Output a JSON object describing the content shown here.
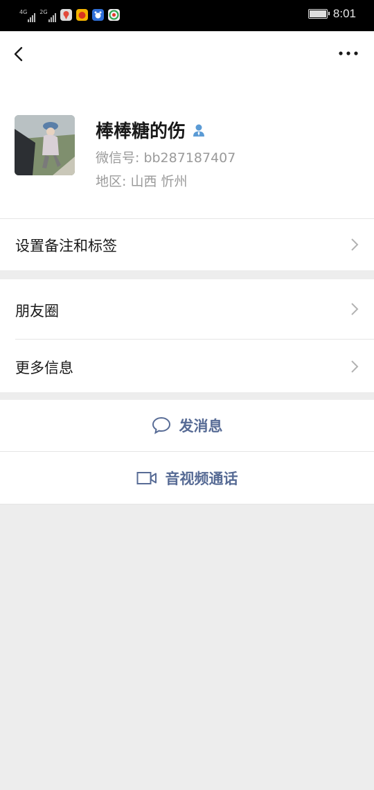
{
  "status_bar": {
    "network_1": "4G",
    "network_2": "2G",
    "time": "8:01"
  },
  "nav": {
    "back_icon": "chevron-left-icon",
    "more_icon": "more-dots-icon"
  },
  "profile": {
    "name": "棒棒糖的伤",
    "wechat_id": "微信号: bb287187407",
    "region": "地区: 山西  忻州",
    "gender_icon": "male-user-icon"
  },
  "menu": {
    "remark_tags": "设置备注和标签",
    "moments": "朋友圈",
    "more_info": "更多信息"
  },
  "actions": {
    "send_message": "发消息",
    "video_call": "音视频通话"
  },
  "colors": {
    "accent_link": "#576b95",
    "background": "#ededed",
    "gender_icon": "#5b9bd5"
  }
}
